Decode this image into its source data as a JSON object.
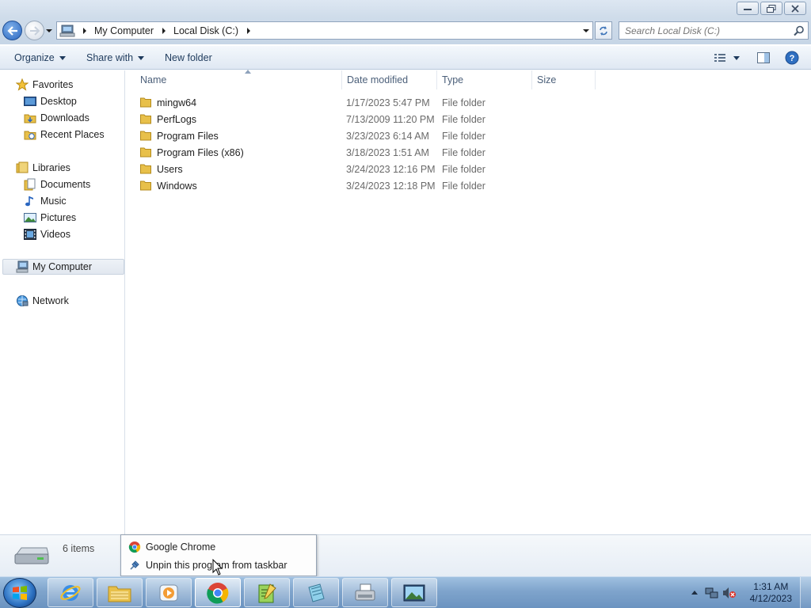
{
  "window": {
    "buttons": {
      "minimize": "minimize",
      "maximize": "maximize",
      "close": "close"
    }
  },
  "address": {
    "crumbs": [
      "My Computer",
      "Local Disk (C:)"
    ],
    "search_placeholder": "Search Local Disk (C:)"
  },
  "toolbar": {
    "organize": "Organize",
    "share_with": "Share with",
    "new_folder": "New folder"
  },
  "nav": {
    "favorites": "Favorites",
    "desktop": "Desktop",
    "downloads": "Downloads",
    "recent_places": "Recent Places",
    "libraries": "Libraries",
    "documents": "Documents",
    "music": "Music",
    "pictures": "Pictures",
    "videos": "Videos",
    "my_computer": "My Computer",
    "network": "Network"
  },
  "columns": {
    "name": "Name",
    "date_modified": "Date modified",
    "type": "Type",
    "size": "Size"
  },
  "files": [
    {
      "name": "mingw64",
      "date": "1/17/2023 5:47 PM",
      "type": "File folder"
    },
    {
      "name": "PerfLogs",
      "date": "7/13/2009 11:20 PM",
      "type": "File folder"
    },
    {
      "name": "Program Files",
      "date": "3/23/2023 6:14 AM",
      "type": "File folder"
    },
    {
      "name": "Program Files (x86)",
      "date": "3/18/2023 1:51 AM",
      "type": "File folder"
    },
    {
      "name": "Users",
      "date": "3/24/2023 12:16 PM",
      "type": "File folder"
    },
    {
      "name": "Windows",
      "date": "3/24/2023 12:18 PM",
      "type": "File folder"
    }
  ],
  "details": {
    "count": "6 items"
  },
  "jumplist": {
    "app": "Google Chrome",
    "unpin": "Unpin this program from taskbar"
  },
  "clock": {
    "time": "1:31 AM",
    "date": "4/12/2023"
  },
  "colors": {
    "folder": "#e8c04a",
    "accent": "#2a66c0"
  }
}
